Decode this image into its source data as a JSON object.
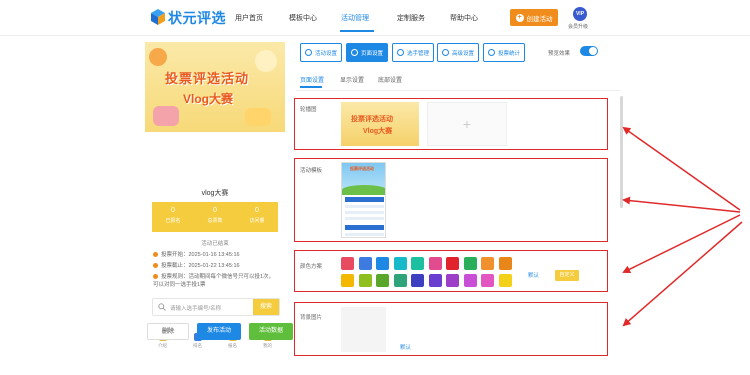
{
  "brand": {
    "name": "状元评选"
  },
  "nav": {
    "items": [
      "用户首页",
      "模板中心",
      "活动管理",
      "定制服务",
      "帮助中心"
    ],
    "create_label": "创建活动",
    "vip_text": "VIP",
    "vip_label": "会员升级"
  },
  "preview": {
    "poster_title": "投票评选活动",
    "poster_subtitle": "Vlog大赛",
    "activity_title": "vlog大赛",
    "stats": [
      {
        "value": "0",
        "label": "已报名"
      },
      {
        "value": "0",
        "label": "总票数"
      },
      {
        "value": "0",
        "label": "访问量"
      }
    ],
    "status": "活动已结束",
    "info": [
      "投票开始：2025-01-16 13:45:16",
      "投票截止：2025-01-22 13:45:16",
      "投票规则：活动期间每个微信号只可以投1次，可以对同一选手投1票"
    ],
    "search_placeholder": "请输入选手编号/名称",
    "search_button": "搜索",
    "tabbar": [
      "介绍",
      "排名",
      "报名",
      "我的"
    ],
    "buttons": {
      "delete": "删除",
      "publish": "发布活动",
      "data": "活动数据"
    }
  },
  "toolbar": {
    "items": [
      "活动设置",
      "页面设置",
      "选手管理",
      "高级设置",
      "投票统计"
    ],
    "active_index": 1,
    "preview_label": "预览效果",
    "preview_on": true
  },
  "subtabs": {
    "items": [
      "页面设置",
      "显示设置",
      "底部设置"
    ],
    "active_index": 0
  },
  "sections": {
    "carousel_label": "轮播图",
    "carousel_thumb_line1": "投票评选活动",
    "carousel_thumb_line2": "Vlog大赛",
    "template_label": "活动模板",
    "template_title": "投票评选活动",
    "color_label": "颜色方案",
    "color_default": "默认",
    "color_custom": "自定义",
    "bg_label": "背景图片",
    "bg_default": "默认"
  },
  "colors": {
    "accent": "#1e88e5",
    "highlight": "#e02a2a",
    "palette_row1": [
      "#e84a5f",
      "#3d7be0",
      "#1e88e5",
      "#18b9c9",
      "#1cc0a0",
      "#e24c8e",
      "#e0232d",
      "#2bae5a",
      "#f0912e",
      "#e8861a"
    ],
    "palette_row2": [
      "#f5b800",
      "#8fbf1f",
      "#5aa62a",
      "#2fa37a",
      "#3b3fc0",
      "#6a3dd1",
      "#9c3ec8",
      "#c94fd6",
      "#e256c2",
      "#f3d11a"
    ]
  }
}
